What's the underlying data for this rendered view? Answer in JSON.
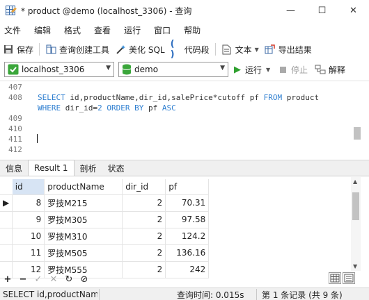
{
  "window": {
    "title": "* product @demo (localhost_3306) - 查询",
    "minimize": "—",
    "maximize": "☐",
    "close": "✕"
  },
  "menu": [
    "文件",
    "编辑",
    "格式",
    "查看",
    "运行",
    "窗口",
    "帮助"
  ],
  "toolbar": {
    "save": "保存",
    "query_builder": "查询创建工具",
    "beautify": "美化 SQL",
    "code_snippet": "代码段",
    "text": "文本",
    "export": "导出结果"
  },
  "connection": {
    "server": "localhost_3306",
    "database": "demo",
    "run": "运行",
    "stop": "停止",
    "explain": "解释"
  },
  "editor": {
    "lines": [
      {
        "no": "407",
        "code": ""
      },
      {
        "no": "408",
        "code": "SELECT id,productName,dir_id,salePrice*cutoff pf FROM product"
      },
      {
        "no": "",
        "code": "WHERE dir_id=2 ORDER BY pf ASC"
      },
      {
        "no": "409",
        "code": ""
      },
      {
        "no": "410",
        "code": ""
      },
      {
        "no": "411",
        "code": ""
      },
      {
        "no": "412",
        "code": ""
      }
    ]
  },
  "tabs": [
    "信息",
    "Result 1",
    "剖析",
    "状态"
  ],
  "active_tab": "Result 1",
  "grid": {
    "columns": [
      "id",
      "productName",
      "dir_id",
      "pf"
    ],
    "rows": [
      [
        "8",
        "罗技M215",
        "2",
        "70.31"
      ],
      [
        "9",
        "罗技M305",
        "2",
        "97.58"
      ],
      [
        "10",
        "罗技M310",
        "2",
        "124.2"
      ],
      [
        "11",
        "罗技M505",
        "2",
        "136.16"
      ],
      [
        "12",
        "罗技M555",
        "2",
        "242"
      ]
    ],
    "current_row": 0
  },
  "statusbar": {
    "sql": "SELECT id,productName",
    "time": "查询时间: 0.015s",
    "records": "第 1 条记录 (共 9 条)"
  }
}
